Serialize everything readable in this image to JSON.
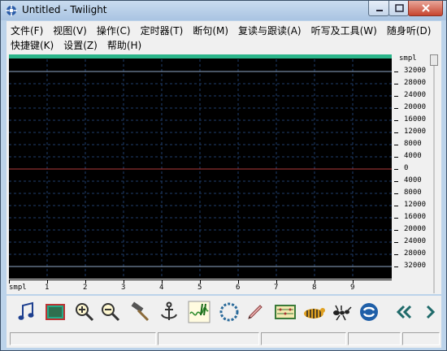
{
  "window": {
    "title": "Untitled - Twilight"
  },
  "menu": {
    "row1": [
      "文件(F)",
      "视图(V)",
      "操作(C)",
      "定时器(T)",
      "断句(M)",
      "复读与跟读(A)",
      "听写及工具(W)",
      "随身听(D)"
    ],
    "row2": [
      "快捷键(K)",
      "设置(Z)",
      "帮助(H)"
    ]
  },
  "waveform": {
    "unit": "smpl",
    "amplitude_labels": [
      "32000",
      "28000",
      "24000",
      "20000",
      "16000",
      "12000",
      "8000",
      "4000",
      "0",
      "4000",
      "8000",
      "12000",
      "16000",
      "20000",
      "24000",
      "28000",
      "32000"
    ],
    "time_labels": [
      "smpl",
      "1",
      "2",
      "3",
      "4",
      "5",
      "6",
      "7",
      "8",
      "9"
    ],
    "colors": {
      "background": "#000000",
      "top_bar": "#2bb58a",
      "center_line": "#b23a3a",
      "grid": "#1f3e6b",
      "rail": "#8fa8c8"
    }
  },
  "toolbar": {
    "icons": [
      "music-note-icon",
      "frame-icon",
      "zoom-in-icon",
      "zoom-out-icon",
      "hammer-icon",
      "anchor-icon",
      "waveform-icon",
      "loop-icon",
      "pencil-icon",
      "abacus-icon",
      "tiger-icon",
      "ant-icon",
      "sync-icon",
      "rewind-icon",
      "forward-icon"
    ]
  },
  "statusbar": {
    "cells": [
      "",
      "",
      "",
      "",
      ""
    ]
  }
}
